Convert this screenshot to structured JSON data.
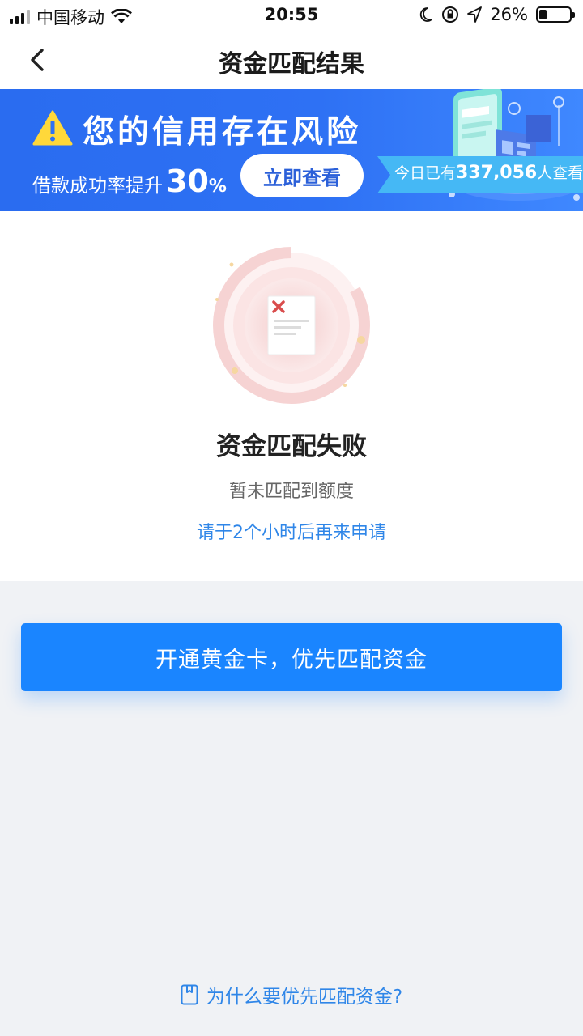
{
  "status_bar": {
    "carrier": "中国移动",
    "time": "20:55",
    "battery": "26%",
    "battery_level": 0.26
  },
  "nav": {
    "title": "资金匹配结果",
    "back_icon": "chevron-left-icon"
  },
  "banner": {
    "title": "您的信用存在风险",
    "subtitle_prefix": "借款成功率提升",
    "subtitle_number": "30",
    "subtitle_percent": "%",
    "button_label": "立即查看",
    "ribbon_prefix": "今日已有",
    "ribbon_count": "337,056",
    "ribbon_suffix": "人查看",
    "colors": {
      "background": "#2e71f4",
      "ribbon": "#45b8f5",
      "warning": "#ffd83a"
    }
  },
  "result": {
    "title": "资金匹配失败",
    "subtitle": "暂未匹配到额度",
    "hint": "请于2个小时后再来申请",
    "icon": "failed-document-icon"
  },
  "cta": {
    "label": "开通黄金卡，优先匹配资金",
    "color": "#1a85ff"
  },
  "footer": {
    "link_label": "为什么要优先匹配资金?",
    "icon": "bookmark-icon"
  }
}
